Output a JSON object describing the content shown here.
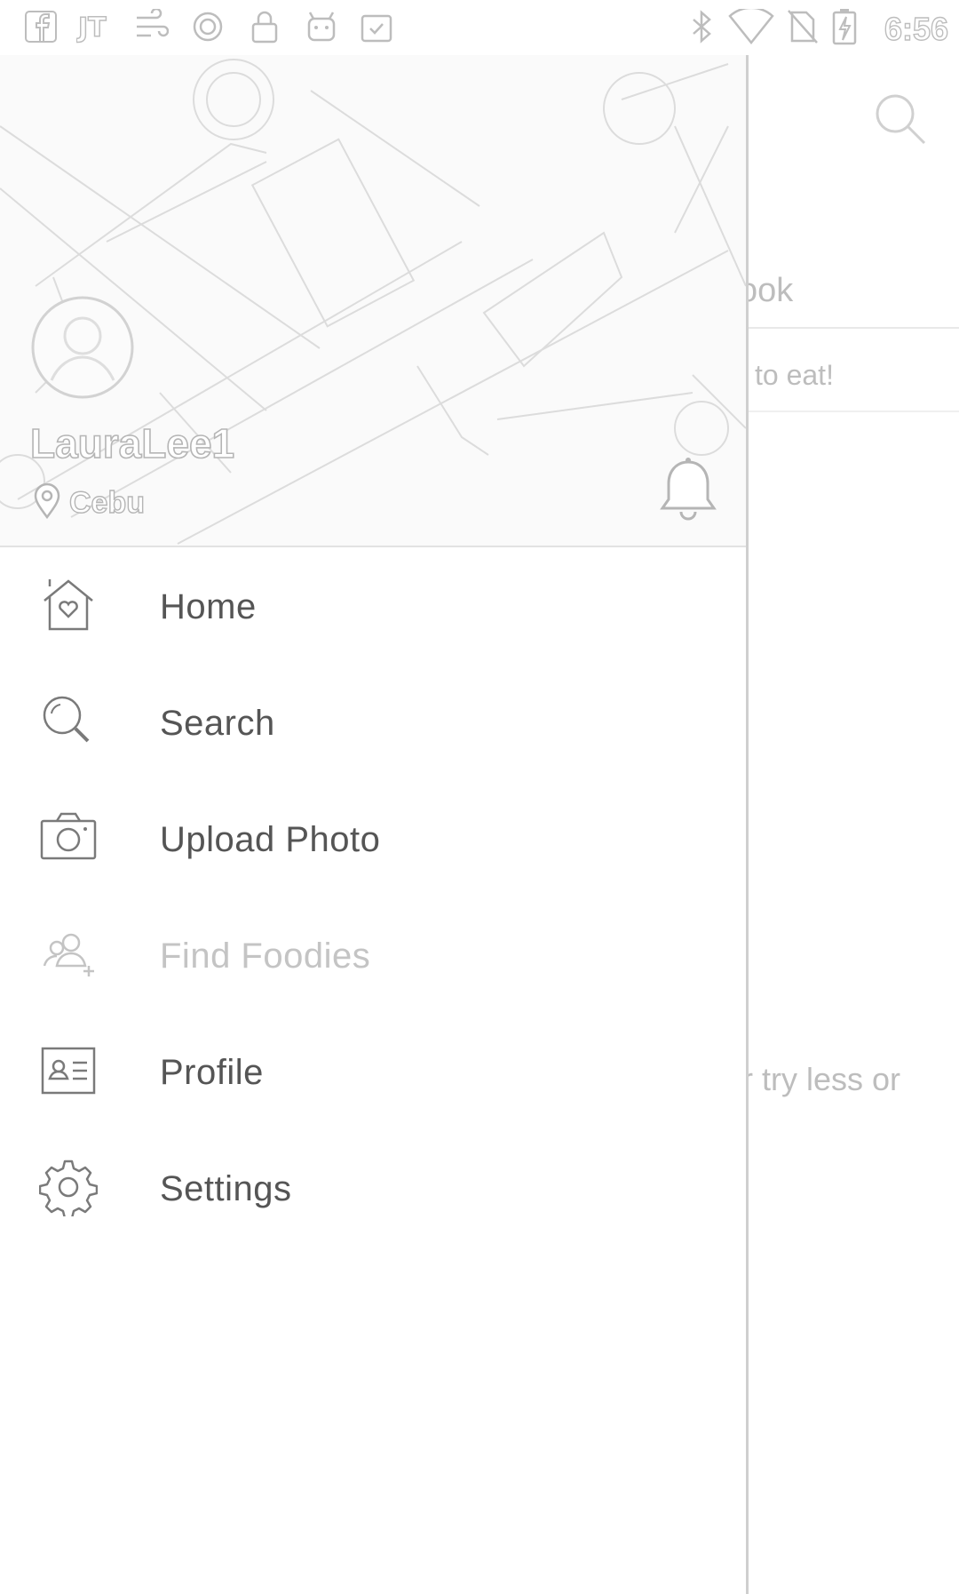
{
  "status_bar": {
    "time": "6:56",
    "left_icons": [
      "facebook-icon",
      "jt-icon",
      "wind-icon",
      "circle-icon",
      "lock-icon",
      "android-icon",
      "clipboard-icon"
    ],
    "right_icons": [
      "bluetooth-icon",
      "wifi-icon",
      "no-sim-icon",
      "battery-charging-icon"
    ]
  },
  "background_app": {
    "partial_texts": [
      "ook",
      "to eat!",
      "r try less or"
    ]
  },
  "drawer": {
    "username": "LauraLee1",
    "location": "Cebu",
    "items": [
      {
        "label": "Home",
        "icon": "home-heart-icon",
        "enabled": true
      },
      {
        "label": "Search",
        "icon": "search-icon",
        "enabled": true
      },
      {
        "label": "Upload Photo",
        "icon": "camera-icon",
        "enabled": true
      },
      {
        "label": "Find Foodies",
        "icon": "add-friends-icon",
        "enabled": false
      },
      {
        "label": "Profile",
        "icon": "profile-card-icon",
        "enabled": true
      },
      {
        "label": "Settings",
        "icon": "gear-icon",
        "enabled": true
      }
    ]
  },
  "colors": {
    "icon_stroke": "#7a7a7a",
    "disabled": "#c4c4c4",
    "outline_text": "#b5b5b5"
  }
}
